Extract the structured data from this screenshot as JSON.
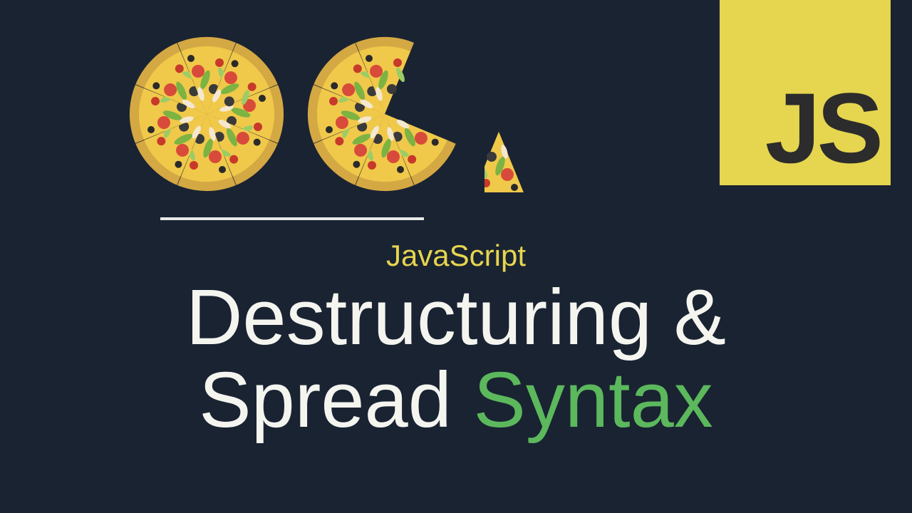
{
  "badge": {
    "label": "JS"
  },
  "title": {
    "subtitle": "JavaScript",
    "line1_a": "Destructuring &",
    "line2_a": "Spread ",
    "line2_b": "Syntax"
  },
  "colors": {
    "bg": "#1a2332",
    "badge_bg": "#e6d54f",
    "accent": "#5cb85c"
  }
}
